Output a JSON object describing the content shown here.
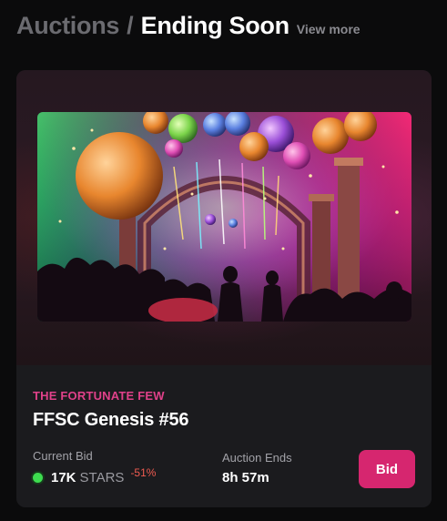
{
  "header": {
    "section": "Auctions",
    "separator": "/",
    "title": "Ending Soon",
    "view_more": "View more"
  },
  "card": {
    "collection": "THE FORTUNATE FEW",
    "name": "FFSC Genesis #56",
    "artwork_description_icon": "party-ballroom-artwork",
    "current_bid_label": "Current Bid",
    "current_bid_amount": "17K",
    "current_bid_currency": "STARS",
    "current_bid_change": "-51%",
    "auction_ends_label": "Auction Ends",
    "auction_ends_value": "8h 57m",
    "bid_button": "Bid"
  },
  "colors": {
    "accent": "#d6266f",
    "collection_text": "#e0418a",
    "negative_change": "#ef5b50",
    "status_dot": "#3ddc4f",
    "background": "#0b0b0c",
    "card_background": "#1b1b1e"
  }
}
